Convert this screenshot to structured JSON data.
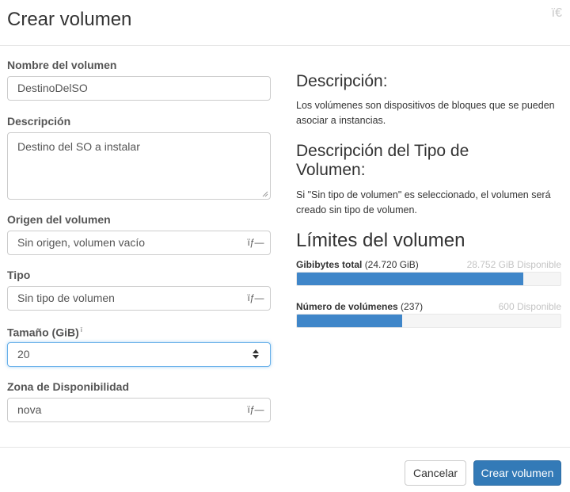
{
  "dialog": {
    "title": "Crear volumen",
    "close_glyph": "ï€"
  },
  "form": {
    "name_label": "Nombre del volumen",
    "name_value": "DestinoDelSO",
    "description_label": "Descripción",
    "description_value": "Destino del SO a instalar",
    "source_label": "Origen del volumen",
    "source_value": "Sin origen, volumen vacío",
    "type_label": "Tipo",
    "type_value": "Sin tipo de volumen",
    "size_label": "Tamaño (GiB)",
    "size_info_glyph": "ï",
    "size_value": "20",
    "az_label": "Zona de Disponibilidad",
    "az_value": "nova",
    "select_arrow_glyph": "ïƒ—"
  },
  "help": {
    "description_heading": "Descripción:",
    "description_text": "Los volúmenes son dispositivos de bloques que se pueden asociar a instancias.",
    "type_heading": "Descripción del Tipo de Volumen:",
    "type_text": "Si \"Sin tipo de volumen\" es seleccionado, el volumen será creado sin tipo de volumen.",
    "limits_heading": "Límites del volumen"
  },
  "quotas": [
    {
      "label": "Gibibytes total",
      "used": "(24.720 GiB)",
      "available": "28.752 GiB Disponible",
      "fill_fraction": 0.86,
      "color": "#3f86c9"
    },
    {
      "label": "Número de volúmenes",
      "used": "(237)",
      "available": "600 Disponible",
      "fill_fraction": 0.4,
      "color": "#3f86c9"
    }
  ],
  "buttons": {
    "cancel_label": "Cancelar",
    "submit_label": "Crear volumen"
  },
  "colors": {
    "primary": "#337ab7",
    "bar_fill": "#3f86c9",
    "focus_border": "#66afe9"
  },
  "icons": {
    "close": "close-icon",
    "select_arrow": "chevron-down-icon",
    "info": "info-icon",
    "spinner": "number-spinner-icon",
    "resize": "resize-handle-icon"
  }
}
